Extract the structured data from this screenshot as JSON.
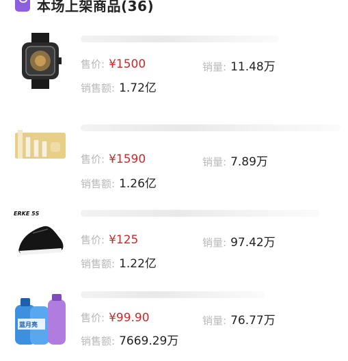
{
  "header": {
    "title": "本场上架商品(36)"
  },
  "labels": {
    "price": "售价:",
    "sales": "销量:",
    "revenue": "销售额:"
  },
  "products": [
    {
      "price": "¥1500",
      "sales": "11.48万",
      "revenue": "1.72亿",
      "thumb": "watch-image"
    },
    {
      "price": "¥1590",
      "sales": "7.89万",
      "revenue": "1.26亿",
      "thumb": "skincare-set-image"
    },
    {
      "price": "¥125",
      "sales": "97.42万",
      "revenue": "1.22亿",
      "thumb": "sneaker-image",
      "brand": "ERKE 5S"
    },
    {
      "price": "¥99.90",
      "sales": "76.77万",
      "revenue": "7669.29万",
      "thumb": "laundry-detergent-image",
      "brand": "蓝月亮"
    }
  ],
  "colors": {
    "accent": "#8d5ee0",
    "price": "#c92a2a",
    "label": "#b9b9b9"
  }
}
